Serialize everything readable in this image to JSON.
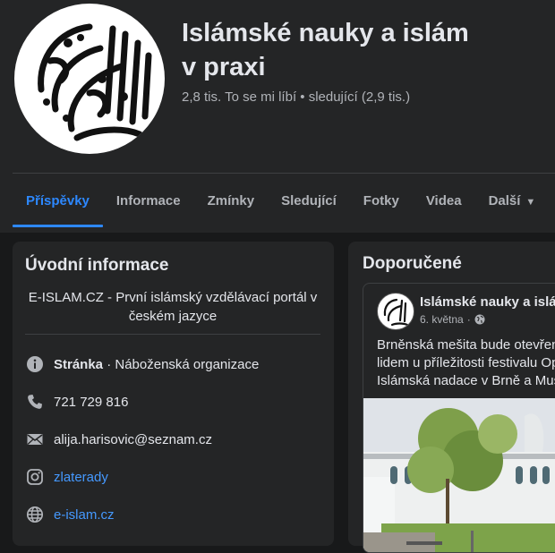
{
  "page": {
    "title_line1": "Islámské nauky a islám",
    "title_line2": "v praxi",
    "stats": "2,8 tis. To se mi líbí • sledující (2,9 tis.)"
  },
  "tabs": [
    {
      "label": "Příspěvky",
      "active": true
    },
    {
      "label": "Informace"
    },
    {
      "label": "Zmínky"
    },
    {
      "label": "Sledující"
    },
    {
      "label": "Fotky"
    },
    {
      "label": "Videa"
    },
    {
      "label": "Další"
    }
  ],
  "intro": {
    "title": "Úvodní informace",
    "bio": "E-ISLAM.CZ - První islámský vzdělávací portál v českém jazyce",
    "category_bold": "Stránka",
    "category_rest": " · Náboženská organizace",
    "phone": "721 729 816",
    "email": "alija.harisovic@seznam.cz",
    "instagram": "zlaterady",
    "website": "e-islam.cz"
  },
  "featured": {
    "title": "Doporučené",
    "post": {
      "author": "Islámské nauky a islám",
      "date": "6. května",
      "text_lines": [
        "Brněnská mešita bude otevřena",
        "lidem u příležitosti festivalu Op",
        "Islámská nadace v Brně a Mus"
      ]
    }
  },
  "colors": {
    "background": "#18191a",
    "card": "#242526",
    "accent": "#2d88ff",
    "link": "#4599ff",
    "secondary_text": "#b0b3b8"
  },
  "icons": [
    "calligraphy-logo",
    "info-icon",
    "phone-icon",
    "email-icon",
    "instagram-icon",
    "globe-icon",
    "public-globe-icon",
    "caret-down-icon"
  ]
}
